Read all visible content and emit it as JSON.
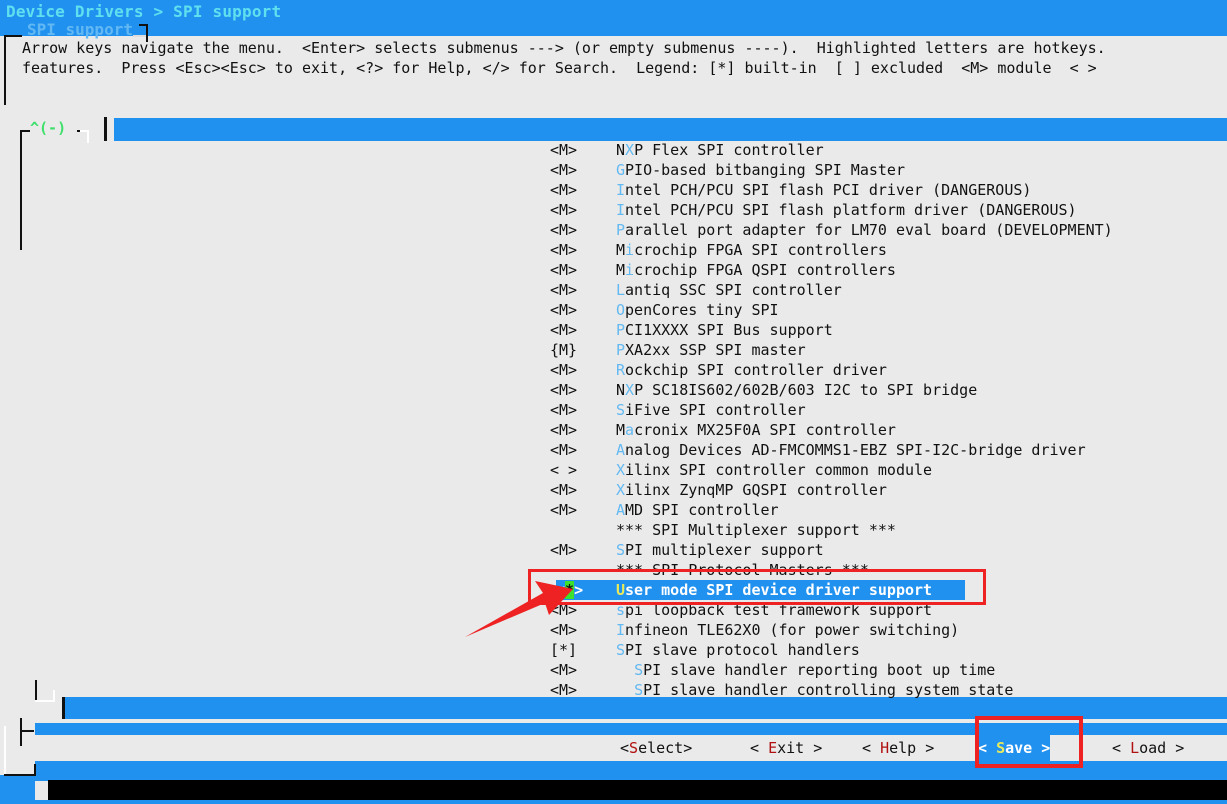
{
  "titlebar": {
    "breadcrumb": "Device Drivers > SPI support"
  },
  "dialog": {
    "frame_title": "SPI support",
    "help_line_1": "Arrow keys navigate the menu.  <Enter> selects submenus ---> (or empty submenus ----).  Highlighted letters are hotkeys.",
    "help_line_2": "features.  Press <Esc><Esc> to exit, <?> for Help, </> for Search.  Legend: [*] built-in  [ ] excluded  <M> module  < >",
    "scroll_up_indicator": "^(-)"
  },
  "menu": {
    "items": [
      {
        "tag": "<M>",
        "hotkey": "X",
        "pre": "N",
        "post": "P Flex SPI controller"
      },
      {
        "tag": "<M>",
        "hotkey": "G",
        "pre": "",
        "post": "PIO-based bitbanging SPI Master"
      },
      {
        "tag": "<M>",
        "hotkey": "I",
        "pre": "",
        "post": "ntel PCH/PCU SPI flash PCI driver (DANGEROUS)"
      },
      {
        "tag": "<M>",
        "hotkey": "I",
        "pre": "",
        "post": "ntel PCH/PCU SPI flash platform driver (DANGEROUS)"
      },
      {
        "tag": "<M>",
        "hotkey": "P",
        "pre": "",
        "post": "arallel port adapter for LM70 eval board (DEVELOPMENT)"
      },
      {
        "tag": "<M>",
        "hotkey": "i",
        "pre": "M",
        "post": "crochip FPGA SPI controllers"
      },
      {
        "tag": "<M>",
        "hotkey": "i",
        "pre": "M",
        "post": "crochip FPGA QSPI controllers"
      },
      {
        "tag": "<M>",
        "hotkey": "L",
        "pre": "",
        "post": "antiq SSC SPI controller"
      },
      {
        "tag": "<M>",
        "hotkey": "O",
        "pre": "",
        "post": "penCores tiny SPI"
      },
      {
        "tag": "<M>",
        "hotkey": "P",
        "pre": "",
        "post": "CI1XXXX SPI Bus support"
      },
      {
        "tag": "{M}",
        "hotkey": "P",
        "pre": "",
        "post": "XA2xx SSP SPI master"
      },
      {
        "tag": "<M>",
        "hotkey": "R",
        "pre": "",
        "post": "ockchip SPI controller driver"
      },
      {
        "tag": "<M>",
        "hotkey": "X",
        "pre": "N",
        "post": "P SC18IS602/602B/603 I2C to SPI bridge"
      },
      {
        "tag": "<M>",
        "hotkey": "S",
        "pre": "",
        "post": "iFive SPI controller"
      },
      {
        "tag": "<M>",
        "hotkey": "a",
        "pre": "M",
        "post": "cronix MX25F0A SPI controller"
      },
      {
        "tag": "<M>",
        "hotkey": "A",
        "pre": "",
        "post": "nalog Devices AD-FMCOMMS1-EBZ SPI-I2C-bridge driver"
      },
      {
        "tag": "< >",
        "hotkey": "X",
        "pre": "",
        "post": "ilinx SPI controller common module"
      },
      {
        "tag": "<M>",
        "hotkey": "X",
        "pre": "",
        "post": "ilinx ZynqMP GQSPI controller"
      },
      {
        "tag": "<M>",
        "hotkey": "A",
        "pre": "",
        "post": "MD SPI controller"
      },
      {
        "tag": "",
        "hotkey": "",
        "pre": "*** SPI Multiplexer support ***",
        "post": ""
      },
      {
        "tag": "<M>",
        "hotkey": "S",
        "pre": "",
        "post": "PI multiplexer support"
      },
      {
        "tag": "",
        "hotkey": "",
        "pre": "*** SPI Protocol Masters ***",
        "post": ""
      },
      {
        "tag": "<*>",
        "hotkey": "U",
        "pre": "",
        "post": "ser mode SPI device driver support",
        "selected": true,
        "cursor_char": "*"
      },
      {
        "tag": "<M>",
        "hotkey": "s",
        "pre": "",
        "post": "pi loopback test framework support"
      },
      {
        "tag": "<M>",
        "hotkey": "I",
        "pre": "",
        "post": "nfineon TLE62X0 (for power switching)"
      },
      {
        "tag": "[*]",
        "hotkey": "S",
        "pre": "",
        "post": "PI slave protocol handlers"
      },
      {
        "tag": "<M>",
        "hotkey": "S",
        "pre": "  ",
        "post": "PI slave handler reporting boot up time"
      },
      {
        "tag": "<M>",
        "hotkey": "S",
        "pre": "  ",
        "post": "PI slave handler controlling system state"
      }
    ]
  },
  "buttons": [
    {
      "name": "select",
      "pre": "<",
      "hotkey": "S",
      "post": "elect>"
    },
    {
      "name": "exit",
      "pre": "< ",
      "hotkey": "E",
      "post": "xit >"
    },
    {
      "name": "help",
      "pre": "< ",
      "hotkey": "H",
      "post": "elp >"
    },
    {
      "name": "save",
      "pre": "< ",
      "hotkey": "S",
      "post": "ave >",
      "focused": true
    },
    {
      "name": "load",
      "pre": "< ",
      "hotkey": "L",
      "post": "oad >"
    }
  ],
  "colors": {
    "blue": "#2191f0",
    "cyan_title": "#5fe0ee",
    "frame_title": "#62b8f2",
    "hotkey_blue": "#63b9f2",
    "hotkey_red": "#b01010",
    "hotkey_yellow": "#e8ea5a",
    "cursor_green": "#3ee02e",
    "scroll_green": "#3ee06b",
    "annotation_red": "#ee2222",
    "background": "#eaeaea"
  }
}
